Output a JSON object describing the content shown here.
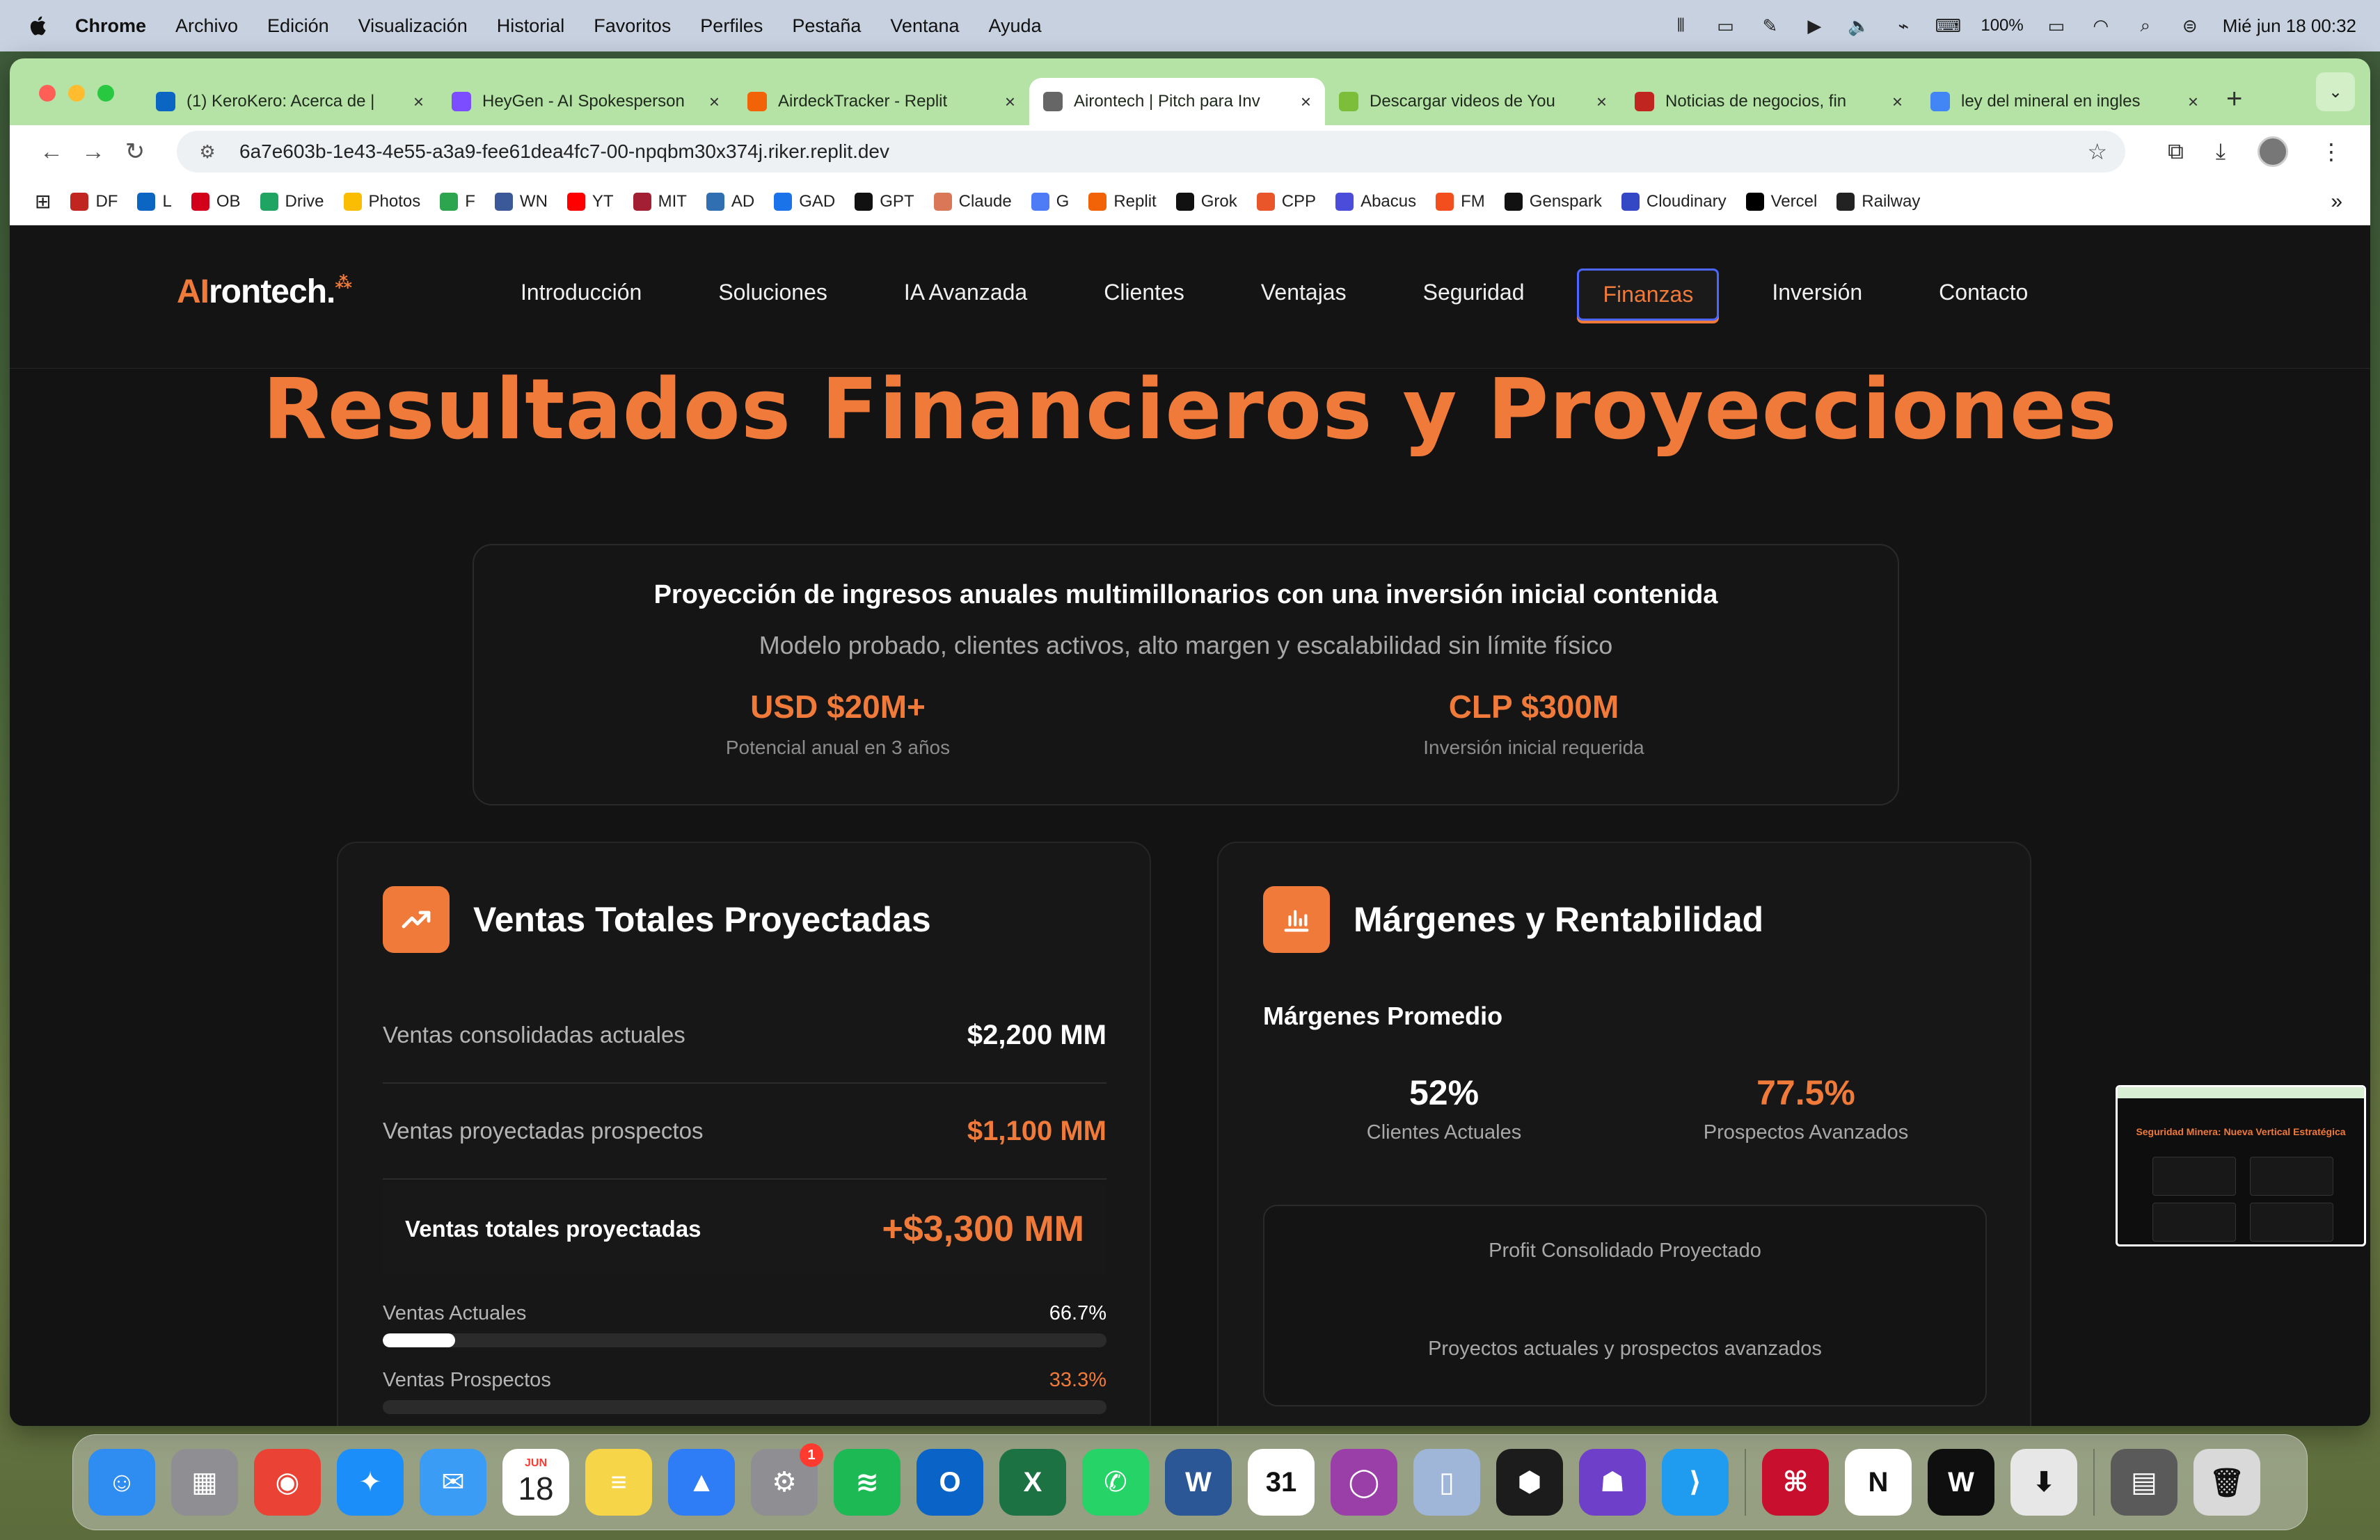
{
  "menubar": {
    "app": "Chrome",
    "items": [
      "Archivo",
      "Edición",
      "Visualización",
      "Historial",
      "Favoritos",
      "Perfiles",
      "Pestaña",
      "Ventana",
      "Ayuda"
    ],
    "battery": "100%",
    "datetime": "Mié jun 18  00:32"
  },
  "tabs": [
    {
      "title": "(1) KeroKero: Acerca de |",
      "icon": "linkedin-icon",
      "color": "#0a66c2"
    },
    {
      "title": "HeyGen - AI Spokesperson",
      "icon": "heygen-icon",
      "color": "#7b4dff"
    },
    {
      "title": "AirdeckTracker - Replit",
      "icon": "replit-icon",
      "color": "#f26207"
    },
    {
      "title": "Airontech | Pitch para Inv",
      "icon": "globe-icon",
      "color": "#666666",
      "active": true
    },
    {
      "title": "Descargar videos de You",
      "icon": "download-site-icon",
      "color": "#7cbd3a"
    },
    {
      "title": "Noticias de negocios, fin",
      "icon": "df-icon",
      "color": "#c0261f"
    },
    {
      "title": "ley del mineral en ingles",
      "icon": "google-icon",
      "color": "#4285f4"
    }
  ],
  "omnibox": {
    "url": "6a7e603b-1e43-4e55-a3a9-fee61dea4fc7-00-npqbm30x374j.riker.replit.dev"
  },
  "bookmarks": [
    {
      "label": "DF",
      "color": "#c0261f"
    },
    {
      "label": "L",
      "color": "#0a66c2"
    },
    {
      "label": "OB",
      "color": "#d3001a"
    },
    {
      "label": "Drive",
      "color": "#1fa463"
    },
    {
      "label": "Photos",
      "color": "#fbbc04"
    },
    {
      "label": "F",
      "color": "#2da44e"
    },
    {
      "label": "WN",
      "color": "#3b5998"
    },
    {
      "label": "YT",
      "color": "#ff0000"
    },
    {
      "label": "MIT",
      "color": "#a31f34"
    },
    {
      "label": "AD",
      "color": "#2f6fb2"
    },
    {
      "label": "GAD",
      "color": "#1a73e8"
    },
    {
      "label": "GPT",
      "color": "#111111"
    },
    {
      "label": "Claude",
      "color": "#d97757"
    },
    {
      "label": "G",
      "color": "#4e7cf6"
    },
    {
      "label": "Replit",
      "color": "#f26207"
    },
    {
      "label": "Grok",
      "color": "#111111"
    },
    {
      "label": "CPP",
      "color": "#e8562a"
    },
    {
      "label": "Abacus",
      "color": "#4c4cdb"
    },
    {
      "label": "FM",
      "color": "#f24e1e"
    },
    {
      "label": "Genspark",
      "color": "#111111"
    },
    {
      "label": "Cloudinary",
      "color": "#3448c5"
    },
    {
      "label": "Vercel",
      "color": "#000000"
    },
    {
      "label": "Railway",
      "color": "#222222"
    }
  ],
  "site": {
    "logo_ai": "AI",
    "logo_rest": "rontech.",
    "nav": [
      "Introducción",
      "Soluciones",
      "IA Avanzada",
      "Clientes",
      "Ventajas",
      "Seguridad",
      "Finanzas",
      "Inversión",
      "Contacto"
    ],
    "active_nav": "Finanzas",
    "accent": "#f07a3a"
  },
  "hero": {
    "title": "Resultados Financieros y Proyecciones",
    "card_heading": "Proyección de ingresos anuales multimillonarios con una inversión inicial contenida",
    "card_sub": "Modelo probado, clientes activos, alto margen y escalabilidad sin límite físico",
    "kpis": [
      {
        "value": "USD $20M+",
        "label": "Potencial anual en 3 años"
      },
      {
        "value": "CLP $300M",
        "label": "Inversión inicial requerida"
      }
    ]
  },
  "sales": {
    "title": "Ventas Totales Proyectadas",
    "rows": [
      {
        "label": "Ventas consolidadas actuales",
        "value": "$2,200 MM"
      },
      {
        "label": "Ventas proyectadas prospectos",
        "value": "$1,100 MM"
      }
    ],
    "total_label": "Ventas totales proyectadas",
    "total_value": "+$3,300 MM",
    "bars": [
      {
        "label": "Ventas Actuales",
        "pct_text": "66.7%",
        "fill": 0.1
      },
      {
        "label": "Ventas Prospectos",
        "pct_text": "33.3%",
        "fill": 0
      }
    ]
  },
  "margins": {
    "title": "Márgenes y Rentabilidad",
    "subtitle": "Márgenes Promedio",
    "kpis": [
      {
        "value": "52%",
        "label": "Clientes Actuales"
      },
      {
        "value": "77.5%",
        "label": "Prospectos Avanzados"
      }
    ],
    "profit_title": "Profit Consolidado Proyectado",
    "profit_sub": "Proyectos actuales y prospectos avanzados"
  },
  "pip": {
    "title": "Seguridad Minera: Nueva Vertical Estratégica"
  },
  "dock": {
    "calendar_month": "JUN",
    "calendar_day": "18",
    "settings_badge": "1",
    "apps": [
      {
        "name": "finder-icon",
        "color": "#2f8cf0",
        "glyph": "☺"
      },
      {
        "name": "launchpad-icon",
        "color": "#8e8e93",
        "glyph": "▦"
      },
      {
        "name": "chrome-icon",
        "color": "#ea4335",
        "glyph": "◉"
      },
      {
        "name": "safari-icon",
        "color": "#1c8ef9",
        "glyph": "✦"
      },
      {
        "name": "mail-icon",
        "color": "#3b9cf5",
        "glyph": "✉"
      },
      {
        "name": "calendar-icon",
        "color": "#ffffff",
        "glyph": ""
      },
      {
        "name": "notes-icon",
        "color": "#f7d548",
        "glyph": "≡"
      },
      {
        "name": "keynote-icon",
        "color": "#2e7cf6",
        "glyph": "▲"
      },
      {
        "name": "system-settings-icon",
        "color": "#8e8e93",
        "glyph": "⚙"
      },
      {
        "name": "spotify-icon",
        "color": "#1db954",
        "glyph": "≋"
      },
      {
        "name": "outlook-icon",
        "color": "#0a64c8",
        "glyph": "O"
      },
      {
        "name": "excel-icon",
        "color": "#1d7244",
        "glyph": "X"
      },
      {
        "name": "whatsapp-icon",
        "color": "#25d366",
        "glyph": "✆"
      },
      {
        "name": "word-icon",
        "color": "#2b5797",
        "glyph": "W"
      },
      {
        "name": "calendar-31-icon",
        "color": "#ffffff",
        "glyph": "31"
      },
      {
        "name": "screen-recorder-icon",
        "color": "#9b3fa8",
        "glyph": "◯"
      },
      {
        "name": "iphone-mirroring-icon",
        "color": "#9fb6d8",
        "glyph": "▯"
      },
      {
        "name": "replit-app-icon",
        "color": "#1c1c1c",
        "glyph": "⬢"
      },
      {
        "name": "github-desktop-icon",
        "color": "#6e40c9",
        "glyph": "☗"
      },
      {
        "name": "vscode-icon",
        "color": "#1f9cf0",
        "glyph": "⟩"
      },
      {
        "name": "acrobat-icon",
        "color": "#c8102e",
        "glyph": "⌘"
      },
      {
        "name": "notion-icon",
        "color": "#ffffff",
        "glyph": "N"
      },
      {
        "name": "webex-icon",
        "color": "#0f0f0f",
        "glyph": "W"
      },
      {
        "name": "installer-icon",
        "color": "#e7e7e7",
        "glyph": "⬇"
      },
      {
        "name": "downloads-stack-icon",
        "color": "#5a5a5a",
        "glyph": "▤"
      },
      {
        "name": "trash-icon",
        "color": "#d9d9d9",
        "glyph": "🗑"
      }
    ]
  }
}
